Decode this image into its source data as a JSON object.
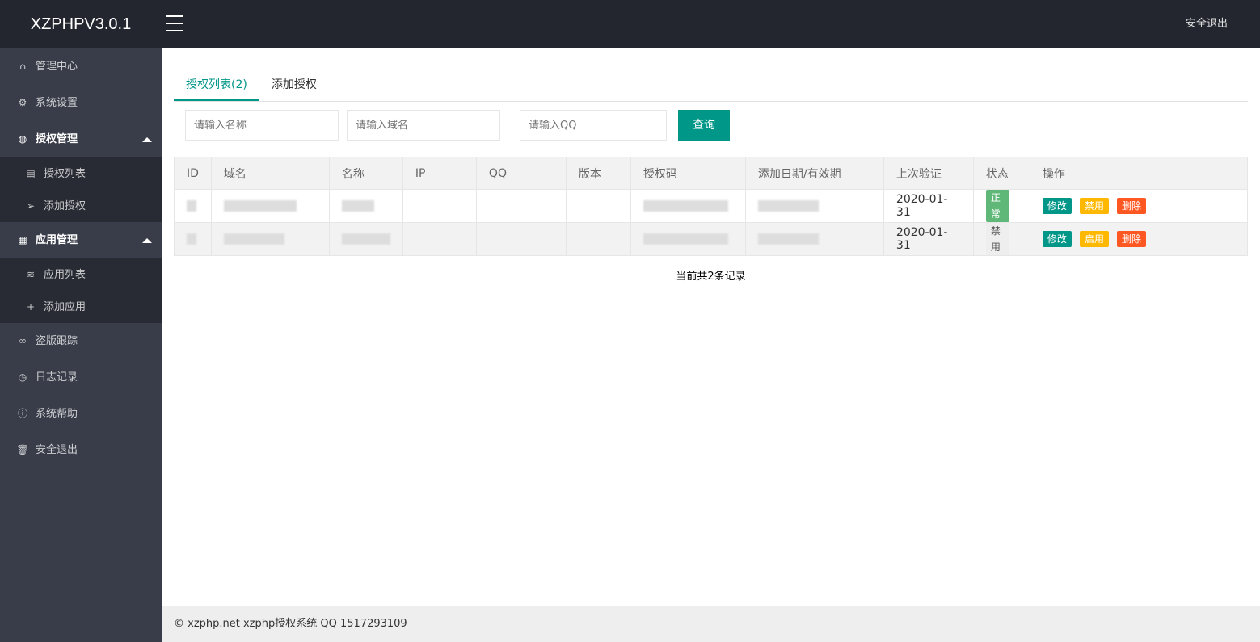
{
  "header": {
    "logo": "XZPHPV3.0.1",
    "logout": "安全退出"
  },
  "sidebar": {
    "items": [
      {
        "label": "管理中心",
        "icon": "home-icon"
      },
      {
        "label": "系统设置",
        "icon": "gear-icon"
      },
      {
        "label": "授权管理",
        "icon": "globe-icon",
        "open": true,
        "children": [
          {
            "label": "授权列表",
            "icon": "file-icon"
          },
          {
            "label": "添加授权",
            "icon": "send-icon"
          }
        ]
      },
      {
        "label": "应用管理",
        "icon": "apps-icon",
        "open": true,
        "children": [
          {
            "label": "应用列表",
            "icon": "layers-icon"
          },
          {
            "label": "添加应用",
            "icon": "plus-icon"
          }
        ]
      },
      {
        "label": "盗版跟踪",
        "icon": "link-icon"
      },
      {
        "label": "日志记录",
        "icon": "clock-icon"
      },
      {
        "label": "系统帮助",
        "icon": "info-icon"
      },
      {
        "label": "安全退出",
        "icon": "trash-icon"
      }
    ]
  },
  "tabs": [
    "授权列表(2)",
    "添加授权"
  ],
  "search": {
    "name_placeholder": "请输入名称",
    "domain_placeholder": "请输入域名",
    "qq_placeholder": "请输入QQ",
    "button": "查询"
  },
  "table": {
    "headers": [
      "ID",
      "域名",
      "名称",
      "IP",
      "QQ",
      "版本",
      "授权码",
      "添加日期/有效期",
      "上次验证",
      "状态",
      "操作"
    ],
    "rows": [
      {
        "last_verify": "2020-01-31",
        "status": "正常",
        "status_color": "#5fb878",
        "actions": [
          "修改",
          "禁用",
          "删除"
        ]
      },
      {
        "last_verify": "2020-01-31",
        "status": "禁用",
        "status_color": "#eeeeee",
        "actions": [
          "修改",
          "启用",
          "删除"
        ]
      }
    ]
  },
  "record_count": "当前共2条记录",
  "colors": {
    "edit": "#009688",
    "toggle": "#ffb800",
    "delete": "#ff5722"
  },
  "footer": "© xzphp.net xzphp授权系统 QQ 1517293109"
}
